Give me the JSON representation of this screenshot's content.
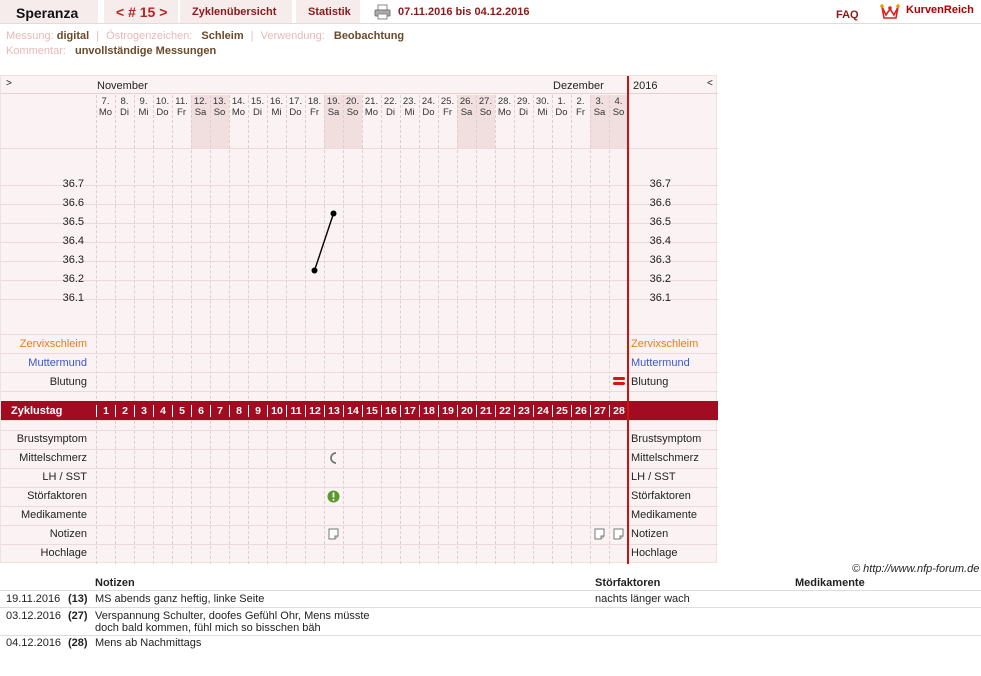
{
  "header": {
    "app_title": "Speranza",
    "cycle_prev": "<",
    "cycle_label": "# 15",
    "cycle_next": ">",
    "tab_overview": "Zyklenübersicht",
    "tab_stats": "Statistik",
    "date_range": "07.11.2016 bis 04.12.2016",
    "faq": "FAQ",
    "logo_text": "KurvenReich"
  },
  "meta": {
    "messung_label": "Messung:",
    "messung_value": "digital",
    "oestrogen_label": "Östrogenzeichen:",
    "oestrogen_value": "Schleim",
    "verwendung_label": "Verwendung:",
    "verwendung_value": "Beobachtung",
    "kommentar_label": "Kommentar:",
    "kommentar_value": "unvollständige Messungen"
  },
  "chart": {
    "nav_left": ">",
    "nav_right": "<",
    "month_november": "November",
    "month_december": "Dezember",
    "year": "2016",
    "days": [
      {
        "d": "7.",
        "w": "Mo"
      },
      {
        "d": "8.",
        "w": "Di"
      },
      {
        "d": "9.",
        "w": "Mi"
      },
      {
        "d": "10.",
        "w": "Do"
      },
      {
        "d": "11.",
        "w": "Fr"
      },
      {
        "d": "12.",
        "w": "Sa"
      },
      {
        "d": "13.",
        "w": "So"
      },
      {
        "d": "14.",
        "w": "Mo"
      },
      {
        "d": "15.",
        "w": "Di"
      },
      {
        "d": "16.",
        "w": "Mi"
      },
      {
        "d": "17.",
        "w": "Do"
      },
      {
        "d": "18.",
        "w": "Fr"
      },
      {
        "d": "19.",
        "w": "Sa"
      },
      {
        "d": "20.",
        "w": "So"
      },
      {
        "d": "21.",
        "w": "Mo"
      },
      {
        "d": "22.",
        "w": "Di"
      },
      {
        "d": "23.",
        "w": "Mi"
      },
      {
        "d": "24.",
        "w": "Do"
      },
      {
        "d": "25.",
        "w": "Fr"
      },
      {
        "d": "26.",
        "w": "Sa"
      },
      {
        "d": "27.",
        "w": "So"
      },
      {
        "d": "28.",
        "w": "Mo"
      },
      {
        "d": "29.",
        "w": "Di"
      },
      {
        "d": "30.",
        "w": "Mi"
      },
      {
        "d": "1.",
        "w": "Do"
      },
      {
        "d": "2.",
        "w": "Fr"
      },
      {
        "d": "3.",
        "w": "Sa"
      },
      {
        "d": "4.",
        "w": "So"
      }
    ],
    "temp_ticks": [
      "36.7",
      "36.6",
      "36.5",
      "36.4",
      "36.3",
      "36.2",
      "36.1"
    ],
    "upper_rows": [
      "Zervixschleim",
      "Muttermund",
      "Blutung"
    ],
    "zyklustag_label": "Zyklustag",
    "cycle_days": [
      "1",
      "2",
      "3",
      "4",
      "5",
      "6",
      "7",
      "8",
      "9",
      "10",
      "11",
      "12",
      "13",
      "14",
      "15",
      "16",
      "17",
      "18",
      "19",
      "20",
      "21",
      "22",
      "23",
      "24",
      "25",
      "26",
      "27",
      "28"
    ],
    "lower_rows": [
      "Brustsymptom",
      "Mittelschmerz",
      "LH / SST",
      "Störfaktoren",
      "Medikamente",
      "Notizen",
      "Hochlage"
    ],
    "colors": {
      "accent": "#a10c21",
      "weekend": "#f1dfe0",
      "zervix": "#e87c12",
      "muttermund": "#3a58c8",
      "stoer": "#5a9a2a"
    }
  },
  "chart_data": {
    "type": "line",
    "title": "",
    "xlabel": "Zyklustag",
    "ylabel": "",
    "ylim": [
      36.0,
      36.8
    ],
    "series": [
      {
        "values": [
          {
            "x": 12,
            "y": 36.25
          },
          {
            "x": 13,
            "y": 36.55
          }
        ]
      }
    ],
    "markers": {
      "blutung": [
        28
      ],
      "mittelschmerz": [
        13
      ],
      "stoerfaktoren": [
        13
      ],
      "notizen": [
        13,
        27,
        28
      ]
    }
  },
  "credit": "© http://www.nfp-forum.de",
  "notes": {
    "headers": {
      "notizen": "Notizen",
      "stoer": "Störfaktoren",
      "medi": "Medikamente"
    },
    "rows": [
      {
        "date": "19.11.2016",
        "day": "(13)",
        "note": "MS abends ganz heftig, linke Seite",
        "stoer": "nachts länger wach"
      },
      {
        "date": "03.12.2016",
        "day": "(27)",
        "note": "Verspannung Schulter, doofes Gefühl Ohr, Mens müsste",
        "note2": "doch bald kommen, fühl mich so bisschen bäh",
        "stoer": ""
      },
      {
        "date": "04.12.2016",
        "day": "(28)",
        "note": "Mens ab Nachmittags",
        "stoer": ""
      }
    ]
  }
}
